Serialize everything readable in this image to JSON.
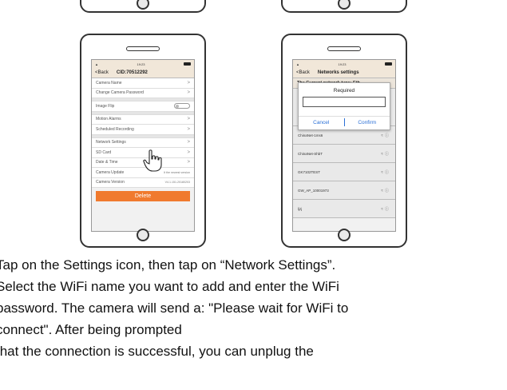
{
  "left_screen": {
    "status_time": "19:23",
    "back": "Back",
    "title": "CID:70512292",
    "rows": [
      {
        "label": "Camera Name",
        "value": ">"
      },
      {
        "label": "Change Camera Password",
        "value": ">"
      },
      {
        "label": "Image Flip",
        "value": ""
      },
      {
        "label": "Motion Alarms",
        "value": ">"
      },
      {
        "label": "Scheduled Recording",
        "value": ">"
      },
      {
        "label": "Network Settings",
        "value": ">"
      },
      {
        "label": "SD Card",
        "value": ">"
      },
      {
        "label": "Date & Time",
        "value": ">"
      },
      {
        "label": "Camera Update",
        "value": "It the newest version"
      },
      {
        "label": "Camera Version",
        "value": "V4.1.151.20180203"
      }
    ],
    "delete_label": "Delete"
  },
  "right_screen": {
    "status_time": "19:23",
    "back": "Back",
    "title": "Networks settings",
    "network_type": "The Current network type: Eth",
    "dialog": {
      "title": "Required",
      "cancel": "Cancel",
      "confirm": "Confirm"
    },
    "networks": [
      {
        "name": "ChinaNet-1ms6"
      },
      {
        "name": "ChinaNet-ShbT"
      },
      {
        "name": "GK7102TEST"
      },
      {
        "name": "GW_AP_10001973"
      },
      {
        "name": "ljzj"
      }
    ],
    "icons": {
      "lock": "lock-icon",
      "wifi": "wifi-icon",
      "info": "info-icon"
    }
  },
  "instructions": [
    "Tap on the Settings icon,  then tap on “Network Settings”.",
    "Select the WiFi name you want to add and enter the WiFi",
    "password. The camera will send a: \"Please wait for WiFi to",
    "connect\". After being prompted",
    "that the connection is successful, you can unplug the"
  ]
}
